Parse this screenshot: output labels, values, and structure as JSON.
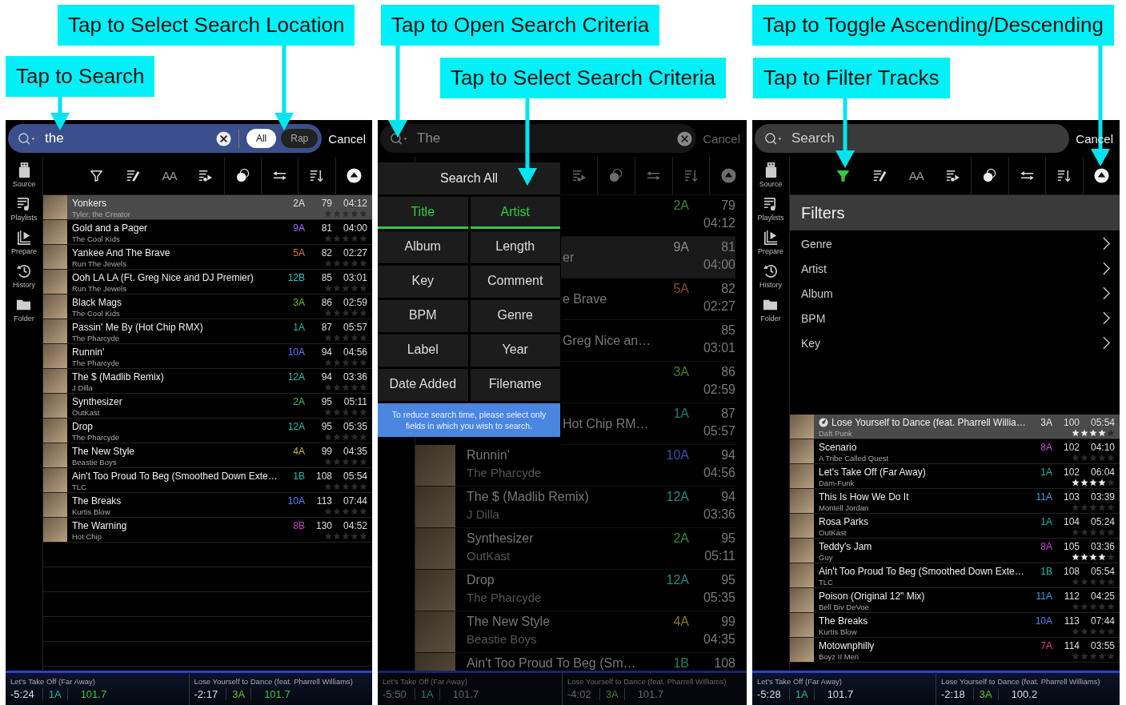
{
  "callouts": [
    {
      "text": "Tap to Select Search Location"
    },
    {
      "text": "Tap to Open Search Criteria"
    },
    {
      "text": "Tap to Toggle Ascending/Descending"
    },
    {
      "text": "Tap to Search"
    },
    {
      "text": "Tap to Select Search Criteria"
    },
    {
      "text": "Tap to Filter Tracks"
    }
  ],
  "search_panel": {
    "search": {
      "value": "the",
      "cancel": "Cancel",
      "locations": [
        {
          "label": "All",
          "selected": true
        },
        {
          "label": "Rap",
          "selected": false
        }
      ]
    },
    "sidebar": [
      {
        "kind": "source",
        "label": "Source"
      },
      {
        "kind": "playlists",
        "label": "Playlists"
      },
      {
        "kind": "prepare",
        "label": "Prepare"
      },
      {
        "kind": "history",
        "label": "History"
      },
      {
        "kind": "folder",
        "label": "Folder"
      }
    ],
    "toolbar": {
      "filter_active": false,
      "text_size_label": "AA"
    },
    "tracks": [
      {
        "title": "Yonkers",
        "artist": "Tyler, the Creator",
        "key": "2A",
        "color": "#e6e6e6",
        "bpm": "79",
        "time": "04:12",
        "stars": 0,
        "selected": true
      },
      {
        "title": "Gold and a Pager",
        "artist": "The Cool Kids",
        "key": "9A",
        "color": "#9b6bff",
        "bpm": "81",
        "time": "04:00",
        "stars": 0,
        "selected": false
      },
      {
        "title": "Yankee And The Brave",
        "artist": "Run The Jewels",
        "key": "5A",
        "color": "#e07a3a",
        "bpm": "82",
        "time": "02:27",
        "stars": 0,
        "selected": false
      },
      {
        "title": "Ooh LA LA (Ft. Greg Nice and DJ Premier)",
        "artist": "Run The Jewels",
        "key": "12B",
        "color": "#2ec4c4",
        "bpm": "85",
        "time": "03:01",
        "stars": 0,
        "selected": false
      },
      {
        "title": "Black Mags",
        "artist": "The Cool Kids",
        "key": "3A",
        "color": "#6cc12a",
        "bpm": "86",
        "time": "02:59",
        "stars": 0,
        "selected": false
      },
      {
        "title": "Passin' Me By (Hot Chip RMX)",
        "artist": "The Pharcyde",
        "key": "1A",
        "color": "#19b8a0",
        "bpm": "87",
        "time": "05:57",
        "stars": 0,
        "selected": false
      },
      {
        "title": "Runnin'",
        "artist": "The Pharcyde",
        "key": "10A",
        "color": "#5a7bff",
        "bpm": "94",
        "time": "04:56",
        "stars": 0,
        "selected": false
      },
      {
        "title": "The $ (Madlib Remix)",
        "artist": "J Dilla",
        "key": "12A",
        "color": "#2bbfb0",
        "bpm": "94",
        "time": "03:36",
        "stars": 0,
        "selected": false
      },
      {
        "title": "Synthesizer",
        "artist": "OutKast",
        "key": "2A",
        "color": "#3fbf5a",
        "bpm": "95",
        "time": "05:11",
        "stars": 0,
        "selected": false
      },
      {
        "title": "Drop",
        "artist": "The Pharcyde",
        "key": "12A",
        "color": "#2bbfb0",
        "bpm": "95",
        "time": "05:35",
        "stars": 0,
        "selected": false
      },
      {
        "title": "The New Style",
        "artist": "Beastie Boys",
        "key": "4A",
        "color": "#c8b030",
        "bpm": "99",
        "time": "04:35",
        "stars": 0,
        "selected": false
      },
      {
        "title": "Ain't Too Proud To Beg (Smoothed Down Exte…",
        "artist": "TLC",
        "key": "1B",
        "color": "#1fc0a0",
        "bpm": "108",
        "time": "05:54",
        "stars": 0,
        "selected": false
      },
      {
        "title": "The Breaks",
        "artist": "Kurtis Blow",
        "key": "10A",
        "color": "#5a7bff",
        "bpm": "113",
        "time": "07:44",
        "stars": 0,
        "selected": false
      },
      {
        "title": "The Warning",
        "artist": "Hot Chip",
        "key": "8B",
        "color": "#c040c0",
        "bpm": "130",
        "time": "04:52",
        "stars": 0,
        "selected": false
      }
    ],
    "decks": [
      {
        "title": "Let's Take Off (Far Away)",
        "time": "-5:24",
        "key": "1A",
        "color": "#19b8a0",
        "bpm": "101.7",
        "synced": true
      },
      {
        "title": "Lose Yourself to Dance (feat. Pharrell Williams)",
        "time": "-2:17",
        "key": "3A",
        "color": "#5cc22a",
        "bpm": "101.7",
        "synced": true
      }
    ]
  },
  "criteria_panel": {
    "search": {
      "value": "The",
      "cancel": "Cancel"
    },
    "menu": {
      "header": "Search All",
      "options": [
        {
          "label": "Title",
          "selected": true
        },
        {
          "label": "Artist",
          "selected": true
        },
        {
          "label": "Album",
          "selected": false
        },
        {
          "label": "Length",
          "selected": false
        },
        {
          "label": "Key",
          "selected": false
        },
        {
          "label": "Comment",
          "selected": false
        },
        {
          "label": "BPM",
          "selected": false
        },
        {
          "label": "Genre",
          "selected": false
        },
        {
          "label": "Label",
          "selected": false
        },
        {
          "label": "Year",
          "selected": false
        },
        {
          "label": "Date Added",
          "selected": false
        },
        {
          "label": "Filename",
          "selected": false
        }
      ],
      "note": "To reduce search time, please select only fields in which you wish to search."
    },
    "tracks": [
      {
        "covered": true,
        "key": "2A",
        "color": "#2f8a3c",
        "bpm": "79",
        "time": "04:12",
        "selected": false
      },
      {
        "covered": true,
        "title": "er",
        "key": "9A",
        "color": "#8a8a8a",
        "bpm": "81",
        "time": "04:00",
        "selected": true
      },
      {
        "covered": true,
        "title": "e Brave",
        "key": "5A",
        "color": "#8a4e2a",
        "bpm": "82",
        "time": "02:27",
        "selected": false
      },
      {
        "covered": true,
        "title": "Greg Nice an…",
        "bpm": "85",
        "time": "03:01",
        "selected": false
      },
      {
        "covered": true,
        "key": "3A",
        "color": "#4a7a20",
        "bpm": "86",
        "time": "02:59",
        "selected": false
      },
      {
        "covered": true,
        "title": "Hot Chip RM…",
        "key": "1A",
        "color": "#14806e",
        "bpm": "87",
        "time": "05:57",
        "selected": false
      },
      {
        "covered": false,
        "title": "Runnin'",
        "artist": "The Pharcyde",
        "key": "10A",
        "color": "#3b50a8",
        "bpm": "94",
        "time": "04:56",
        "selected": false
      },
      {
        "covered": false,
        "title": "The $ (Madlib Remix)",
        "artist": "J Dilla",
        "key": "12A",
        "color": "#1f8a80",
        "bpm": "94",
        "time": "03:36",
        "selected": false
      },
      {
        "covered": false,
        "title": "Synthesizer",
        "artist": "OutKast",
        "key": "2A",
        "color": "#2f8a3c",
        "bpm": "95",
        "time": "05:11",
        "selected": false
      },
      {
        "covered": false,
        "title": "Drop",
        "artist": "The Pharcyde",
        "key": "12A",
        "color": "#1f8a80",
        "bpm": "95",
        "time": "05:35",
        "selected": false
      },
      {
        "covered": false,
        "title": "The New Style",
        "artist": "Beastie Boys",
        "key": "4A",
        "color": "#8a7a24",
        "bpm": "99",
        "time": "04:35",
        "selected": false
      },
      {
        "covered": false,
        "title": "Ain't Too Proud To Beg (Sm…",
        "key": "1B",
        "color": "#15806a",
        "bpm": "108",
        "selected": false
      }
    ],
    "decks": [
      {
        "title": "Let's Take Off (Far Away)",
        "time": "-5:50",
        "key": "1A",
        "color": "#14806e",
        "bpm": "101.7",
        "synced": false
      },
      {
        "title": "Lose Yourself to Dance (feat. Pharrell Williams)",
        "time": "-4:02",
        "key": "3A",
        "color": "#4a7a20",
        "bpm": "101.7",
        "synced": false
      }
    ]
  },
  "filter_panel": {
    "search": {
      "placeholder": "Search",
      "cancel": "Cancel"
    },
    "sidebar": [
      {
        "kind": "source",
        "label": "Source"
      },
      {
        "kind": "playlists",
        "label": "Playlists"
      },
      {
        "kind": "prepare",
        "label": "Prepare"
      },
      {
        "kind": "history",
        "label": "History"
      },
      {
        "kind": "folder",
        "label": "Folder"
      }
    ],
    "toolbar": {
      "filter_active": true,
      "text_size_label": "AA"
    },
    "filters": {
      "title": "Filters",
      "items": [
        {
          "label": "Genre"
        },
        {
          "label": "Artist"
        },
        {
          "label": "Album"
        },
        {
          "label": "BPM"
        },
        {
          "label": "Key"
        }
      ]
    },
    "tracks": [
      {
        "title": "Lose Yourself to Dance (feat. Pharrell Willia…",
        "artist": "Daft Punk",
        "key": "3A",
        "color": "#e6e6e6",
        "bpm": "100",
        "time": "05:54",
        "stars": 4,
        "selected": true,
        "loaded": true
      },
      {
        "title": "Scenario",
        "artist": "A Tribe Called Quest",
        "key": "8A",
        "color": "#c050d0",
        "bpm": "102",
        "time": "04:10",
        "stars": 0,
        "selected": false,
        "loaded": false
      },
      {
        "title": "Let's Take Off (Far Away)",
        "artist": "Dam-Funk",
        "key": "1A",
        "color": "#19b8a0",
        "bpm": "102",
        "time": "06:04",
        "stars": 4,
        "selected": false,
        "loaded": false
      },
      {
        "title": "This Is How We Do It",
        "artist": "Montell Jordan",
        "key": "11A",
        "color": "#3aa0e0",
        "bpm": "103",
        "time": "03:39",
        "stars": 0,
        "selected": false,
        "loaded": false
      },
      {
        "title": "Rosa Parks",
        "artist": "OutKast",
        "key": "1A",
        "color": "#19b8a0",
        "bpm": "104",
        "time": "05:24",
        "stars": 0,
        "selected": false,
        "loaded": false
      },
      {
        "title": "Teddy's Jam",
        "artist": "Guy",
        "key": "8A",
        "color": "#c050d0",
        "bpm": "105",
        "time": "03:36",
        "stars": 4,
        "selected": false,
        "loaded": false
      },
      {
        "title": "Ain't Too Proud To Beg (Smoothed Down Exte…",
        "artist": "TLC",
        "key": "1B",
        "color": "#1fc0a0",
        "bpm": "108",
        "time": "05:54",
        "stars": 0,
        "selected": false,
        "loaded": false
      },
      {
        "title": "Poison (Original 12\" Mix)",
        "artist": "Bell Biv DeVoe",
        "key": "11A",
        "color": "#3aa0e0",
        "bpm": "112",
        "time": "04:25",
        "stars": 0,
        "selected": false,
        "loaded": false
      },
      {
        "title": "The Breaks",
        "artist": "Kurtis Blow",
        "key": "10A",
        "color": "#5a7bff",
        "bpm": "113",
        "time": "07:44",
        "stars": 0,
        "selected": false,
        "loaded": false
      },
      {
        "title": "Motownphilly",
        "artist": "Boyz II Men",
        "key": "7A",
        "color": "#e04080",
        "bpm": "114",
        "time": "03:55",
        "stars": 0,
        "selected": false,
        "loaded": false
      }
    ],
    "decks": [
      {
        "title": "Let's Take Off (Far Away)",
        "time": "-5:28",
        "key": "1A",
        "color": "#19b8a0",
        "bpm": "101.7",
        "synced": false
      },
      {
        "title": "Lose Yourself to Dance (feat. Pharrell Williams)",
        "time": "-2:18",
        "key": "3A",
        "color": "#5cc22a",
        "bpm": "100.2",
        "synced": false
      }
    ]
  }
}
